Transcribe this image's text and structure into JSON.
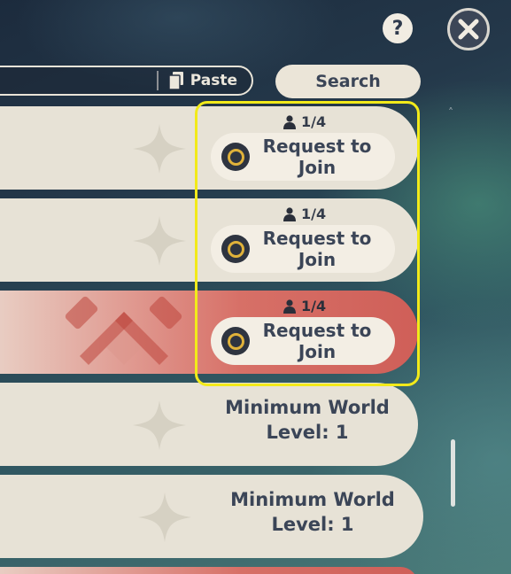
{
  "header": {
    "help_label": "?",
    "close_icon": "close-icon"
  },
  "search": {
    "paste_label": "Paste",
    "search_label": "Search"
  },
  "rows": [
    {
      "players": "1/4",
      "action": "Request to Join"
    },
    {
      "players": "1/4",
      "action": "Request to Join"
    },
    {
      "players": "1/4",
      "action": "Request to Join",
      "style": "host-red"
    },
    {
      "requirement": "Minimum World Level: 1"
    },
    {
      "requirement": "Minimum World Level: 1"
    }
  ],
  "colors": {
    "panel": "#e7e2d6",
    "host_red": "#cf5f58",
    "button_text": "#3b4557",
    "highlight": "#f2ea1a",
    "coin": "#e0b23a"
  }
}
